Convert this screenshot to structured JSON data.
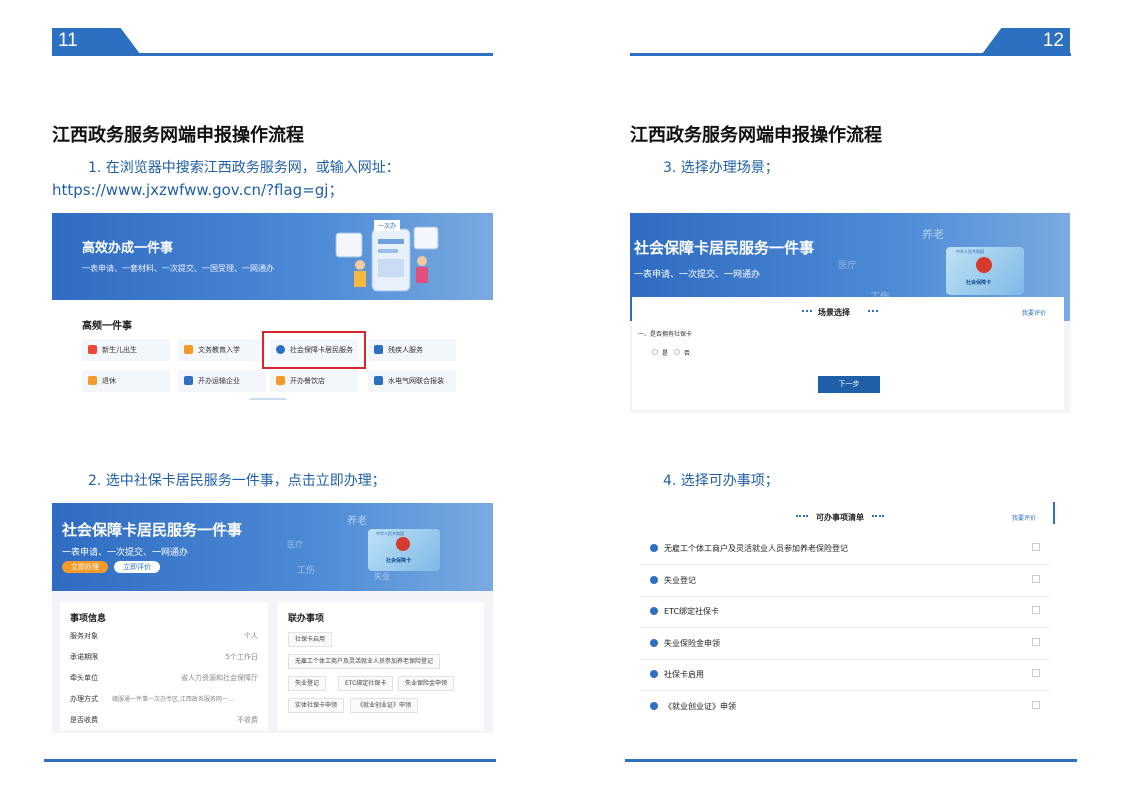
{
  "page_left": {
    "number": "11"
  },
  "page_right": {
    "number": "12"
  },
  "title": "江西政务服务网端申报操作流程",
  "steps": {
    "s1_line1": "1. 在浏览器中搜索江西政务服务网，或输入网址：",
    "s1_line2": "https://www.jxzwfww.gov.cn/?flag=gj；",
    "s2": "2. 选中社保卡居民服务一件事，点击立即办理；",
    "s3": "3. 选择办理场景；",
    "s4": "4. 选择可办事项；"
  },
  "shot1": {
    "banner_title": "高效办成一件事",
    "banner_sub": "一表申请、一套材料、一次提交、一国受理、一网通办",
    "banner_sign": "一次办",
    "section": "高频一件事",
    "items": [
      "新生儿出生",
      "文务教育入学",
      "社会保障卡居民服务",
      "残疾人服务",
      "退休",
      "开办运输企业",
      "开办餐饮店",
      "水电气网联合报装"
    ],
    "colors": [
      "#e8493b",
      "#f29b2a",
      "#2d6fc0",
      "#2d6fc0",
      "#f29b2a",
      "#2d6fc0",
      "#f29b2a",
      "#2d6fc0"
    ]
  },
  "card_banner": {
    "title": "社会保障卡居民服务一件事",
    "sub": "一表申请、一次提交、一网通办",
    "w1": "养老",
    "w2": "医疗",
    "w3": "工伤",
    "w4": "失业",
    "card_top": "中华人民共和国",
    "card_label": "社会保障卡"
  },
  "shot2": {
    "btn_apply": "立即办理",
    "btn_eval": "立即评价",
    "info_title": "事项信息",
    "info_rows": [
      {
        "k": "服务对象",
        "v": "个人"
      },
      {
        "k": "承诺期限",
        "v": "5个工作日"
      },
      {
        "k": "牵头单位",
        "v": "省人力资源和社会保障厅"
      },
      {
        "k": "办理方式",
        "v": "赣服通一件事一次办专区,江西政务服务网一..."
      },
      {
        "k": "是否收费",
        "v": "不收费"
      }
    ],
    "rel_title": "联办事项",
    "tags": [
      "社保卡启用",
      "无雇工个体工商户及灵活就业人员参加养老保险登记",
      "失业登记",
      "ETC绑定社保卡",
      "失业保险金申领",
      "实体社保卡申领",
      "《就业创业证》申领"
    ]
  },
  "shot3": {
    "scene_title": "场景选择",
    "eval": "我要评价",
    "question": "一、是否拥有社保卡",
    "yes": "是",
    "no": "否",
    "next": "下一步"
  },
  "shot4": {
    "list_title": "可办事项清单",
    "eval": "我要评价",
    "items": [
      "无雇工个体工商户及灵活就业人员参加养老保险登记",
      "失业登记",
      "ETC绑定社保卡",
      "失业保险金申领",
      "社保卡启用",
      "《就业创业证》申领"
    ]
  }
}
